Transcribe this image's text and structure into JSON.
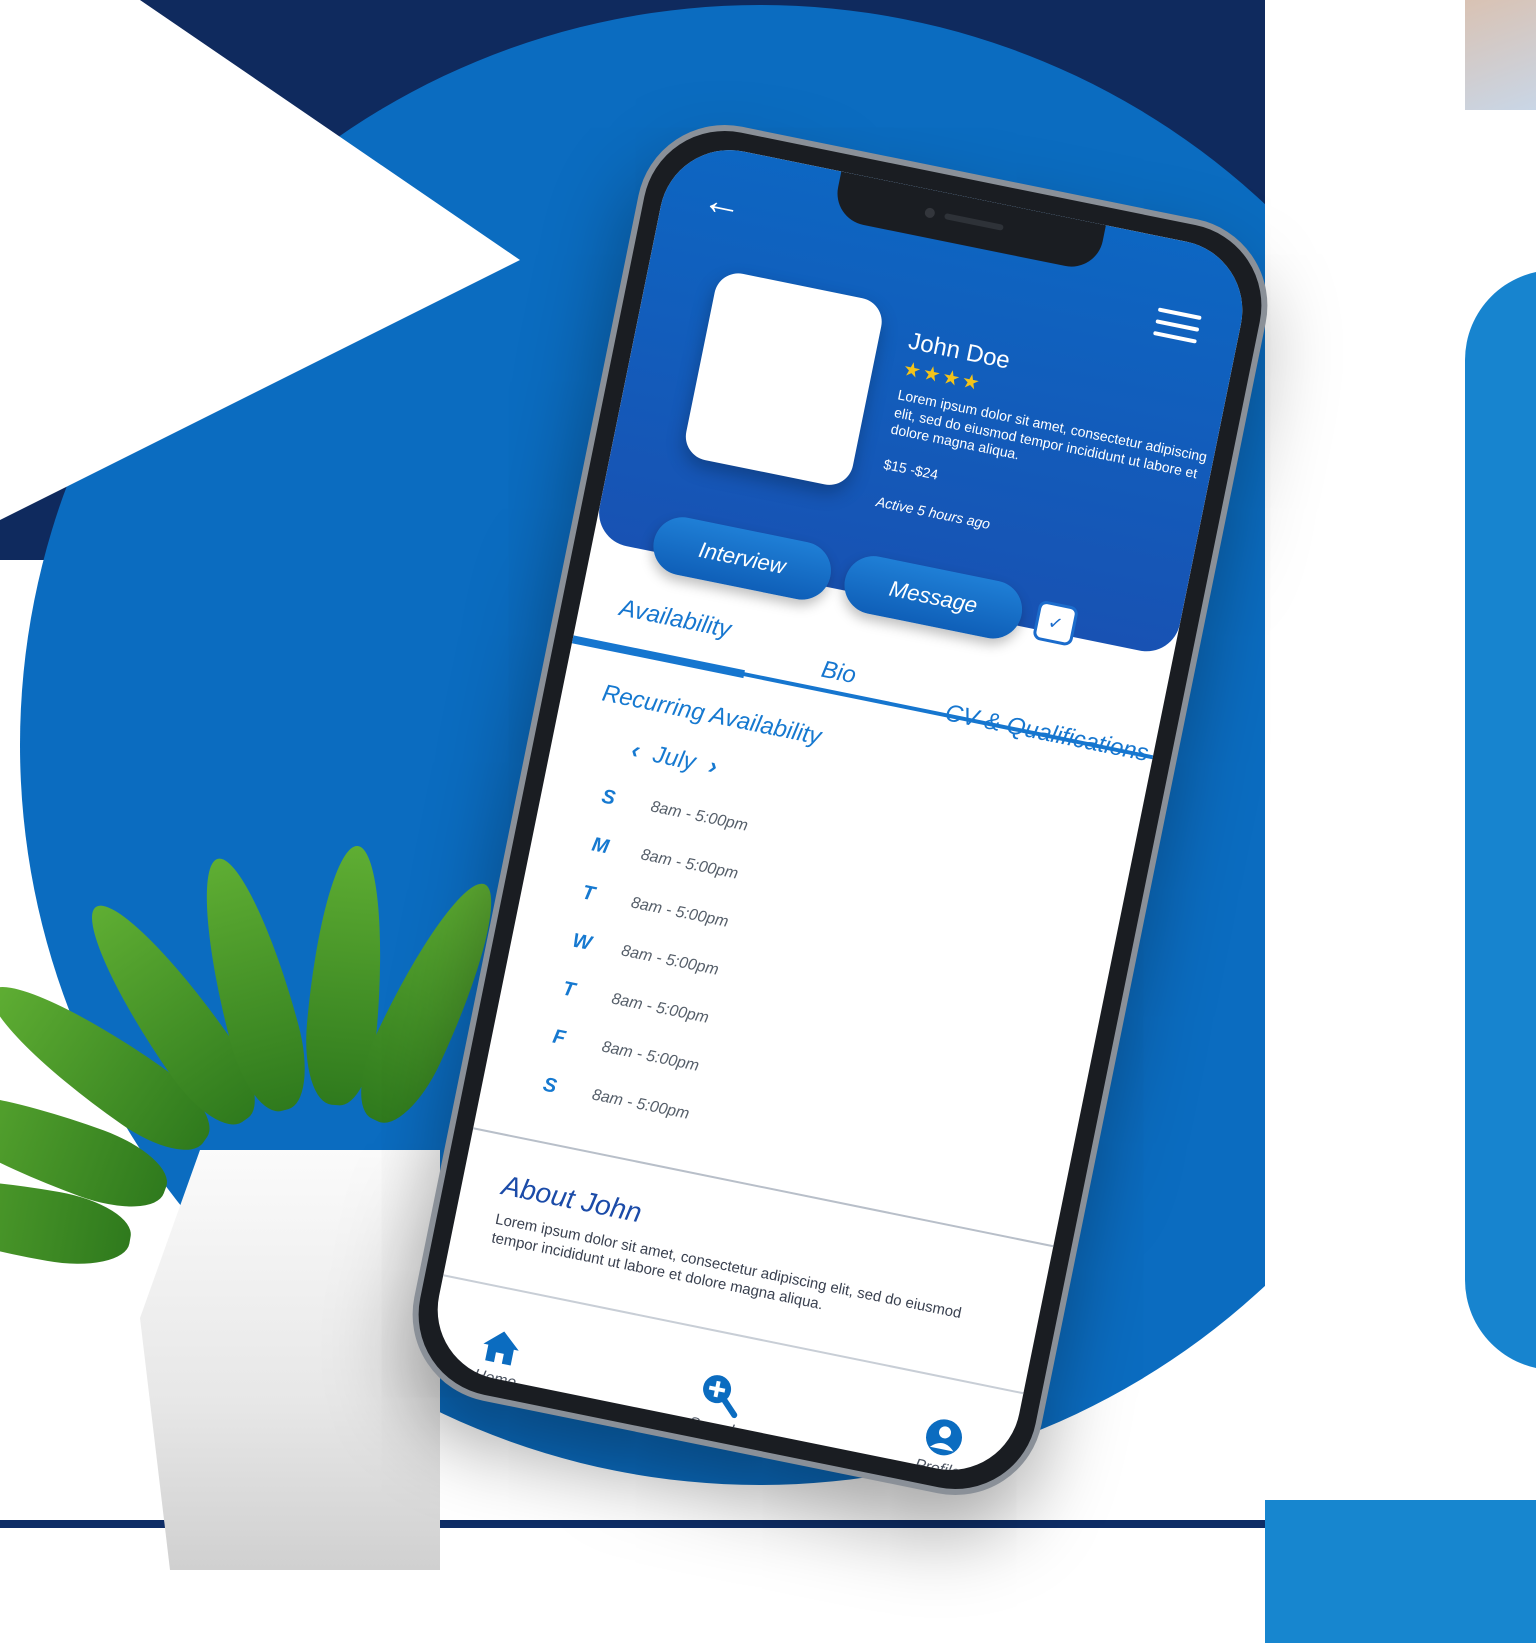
{
  "header": {
    "back_icon": "back-arrow-icon",
    "menu_icon": "hamburger-menu-icon"
  },
  "profile": {
    "name": "John Doe",
    "stars": "★★★★",
    "bio": "Lorem ipsum dolor sit amet, consectetur adipiscing elit, sed do eiusmod tempor incididunt ut labore et dolore magna aliqua.",
    "rate": "$15 -$24",
    "active": "Active 5 hours ago"
  },
  "actions": {
    "interview_label": "Interview",
    "message_label": "Message",
    "dropdown_icon": "chevron-down-icon"
  },
  "tabs": [
    {
      "label": "Availability",
      "active": true
    },
    {
      "label": "Bio",
      "active": false
    },
    {
      "label": "CV & Qualifications",
      "active": false
    }
  ],
  "availability": {
    "title": "Recurring Availability",
    "month": "July",
    "days": [
      {
        "day": "S",
        "hours": "8am - 5:00pm"
      },
      {
        "day": "M",
        "hours": "8am - 5:00pm"
      },
      {
        "day": "T",
        "hours": "8am - 5:00pm"
      },
      {
        "day": "W",
        "hours": "8am - 5:00pm"
      },
      {
        "day": "T",
        "hours": "8am - 5:00pm"
      },
      {
        "day": "F",
        "hours": "8am - 5:00pm"
      },
      {
        "day": "S",
        "hours": "8am - 5:00pm"
      }
    ]
  },
  "about": {
    "title": "About John",
    "text": "Lorem ipsum dolor sit amet, consectetur adipiscing elit, sed do eiusmod tempor incididunt ut labore et dolore magna aliqua."
  },
  "bottom_nav": [
    {
      "label": "Home",
      "icon": "home-icon"
    },
    {
      "label": "Search",
      "icon": "search-plus-icon"
    },
    {
      "label": "Profile",
      "icon": "profile-icon"
    }
  ],
  "colors": {
    "primary_blue": "#0b6cc0",
    "navy": "#0f2a5e",
    "accent_star": "#f3c319"
  }
}
